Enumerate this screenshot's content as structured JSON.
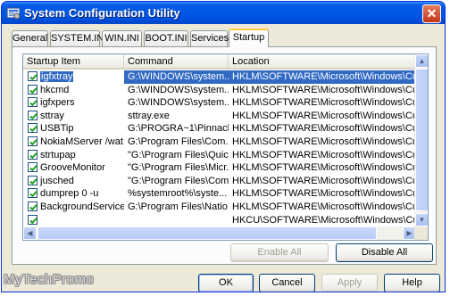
{
  "window": {
    "title": "System Configuration Utility",
    "close_glyph": "✕"
  },
  "tabs": [
    {
      "label": "General"
    },
    {
      "label": "SYSTEM.INI"
    },
    {
      "label": "WIN.INI"
    },
    {
      "label": "BOOT.INI"
    },
    {
      "label": "Services"
    },
    {
      "label": "Startup"
    }
  ],
  "active_tab": "Startup",
  "list": {
    "columns": [
      "Startup Item",
      "Command",
      "Location"
    ],
    "rows": [
      {
        "item": "igfxtray",
        "command": "G:\\WINDOWS\\system...",
        "location": "HKLM\\SOFTWARE\\Microsoft\\Windows\\CurrentVer...",
        "checked": true,
        "selected": true
      },
      {
        "item": "hkcmd",
        "command": "G:\\WINDOWS\\system...",
        "location": "HKLM\\SOFTWARE\\Microsoft\\Windows\\CurrentVer...",
        "checked": true,
        "selected": false
      },
      {
        "item": "igfxpers",
        "command": "G:\\WINDOWS\\system...",
        "location": "HKLM\\SOFTWARE\\Microsoft\\Windows\\CurrentVer...",
        "checked": true,
        "selected": false
      },
      {
        "item": "sttray",
        "command": "sttray.exe",
        "location": "HKLM\\SOFTWARE\\Microsoft\\Windows\\CurrentVer...",
        "checked": true,
        "selected": false
      },
      {
        "item": "USBTip",
        "command": "G:\\PROGRA~1\\Pinnacl...",
        "location": "HKLM\\SOFTWARE\\Microsoft\\Windows\\CurrentVer...",
        "checked": true,
        "selected": false
      },
      {
        "item": "NokiaMServer /wat...",
        "command": "G:\\Program Files\\Com...",
        "location": "HKLM\\SOFTWARE\\Microsoft\\Windows\\CurrentVer...",
        "checked": true,
        "selected": false
      },
      {
        "item": "strtupap",
        "command": "\"G:\\Program Files\\Quic...",
        "location": "HKLM\\SOFTWARE\\Microsoft\\Windows\\CurrentVer...",
        "checked": true,
        "selected": false
      },
      {
        "item": "GrooveMonitor",
        "command": "\"G:\\Program Files\\Micr...",
        "location": "HKLM\\SOFTWARE\\Microsoft\\Windows\\CurrentVer...",
        "checked": true,
        "selected": false
      },
      {
        "item": "jusched",
        "command": "\"G:\\Program Files\\Com...",
        "location": "HKLM\\SOFTWARE\\Microsoft\\Windows\\CurrentVer...",
        "checked": true,
        "selected": false
      },
      {
        "item": "dumprep 0 -u",
        "command": "%systemroot%\\syste...",
        "location": "HKLM\\SOFTWARE\\Microsoft\\Windows\\CurrentVer...",
        "checked": true,
        "selected": false
      },
      {
        "item": "BackgroundService",
        "command": "G:\\Program Files\\Natio...",
        "location": "HKLM\\SOFTWARE\\Microsoft\\Windows\\CurrentVer...",
        "checked": true,
        "selected": false
      },
      {
        "item": "",
        "command": "",
        "location": "HKCU\\SOFTWARE\\Microsoft\\Windows\\CurrentVer...",
        "checked": true,
        "selected": false
      }
    ]
  },
  "buttons": {
    "enable_all": "Enable All",
    "disable_all": "Disable All",
    "ok": "OK",
    "cancel": "Cancel",
    "apply": "Apply",
    "help": "Help"
  },
  "watermark": "MyTechPromo",
  "colors": {
    "title_bar": "#0054e3",
    "selection": "#316ac5",
    "active_tab_accent": "#ffc83c"
  }
}
